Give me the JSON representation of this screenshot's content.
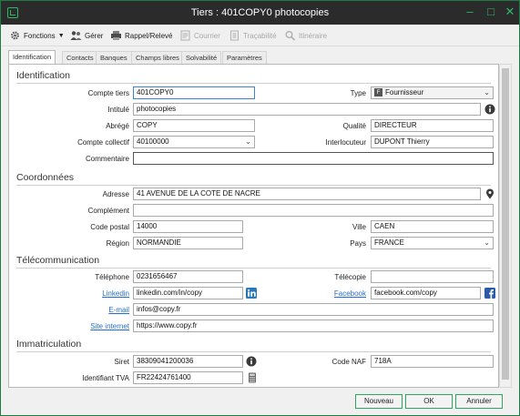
{
  "window": {
    "title": "Tiers : 401COPY0 photocopies",
    "accent": "#2fb66a"
  },
  "toolbar": {
    "fonctions": "Fonctions",
    "gerer": "Gérer",
    "rappel": "Rappel/Relevé",
    "courrier": "Courrier",
    "tracabilite": "Traçabilité",
    "itineraire": "Itinéraire"
  },
  "tabs": [
    "Identification",
    "Contacts",
    "Banques",
    "Champs libres",
    "Solvabilité",
    "Paramètres"
  ],
  "sections": {
    "identification": "Identification",
    "coordonnees": "Coordonnées",
    "telecommunication": "Télécommunication",
    "immatriculation": "Immatriculation"
  },
  "identification": {
    "compte_tiers_label": "Compte tiers",
    "compte_tiers": "401COPY0",
    "type_label": "Type",
    "type_badge": "F",
    "type": "Fournisseur",
    "intitule_label": "Intitulé",
    "intitule": "photocopies",
    "abrege_label": "Abrégé",
    "abrege": "COPY",
    "qualite_label": "Qualité",
    "qualite": "DIRECTEUR",
    "compte_collectif_label": "Compte collectif",
    "compte_collectif": "40100000",
    "interlocuteur_label": "Interlocuteur",
    "interlocuteur": "DUPONT Thierry",
    "commentaire_label": "Commentaire",
    "commentaire": ""
  },
  "coordonnees": {
    "adresse_label": "Adresse",
    "adresse": "41 AVENUE DE LA COTE DE NACRE",
    "complement_label": "Complément",
    "complement": "",
    "code_postal_label": "Code postal",
    "code_postal": "14000",
    "ville_label": "Ville",
    "ville": "CAEN",
    "region_label": "Région",
    "region": "NORMANDIE",
    "pays_label": "Pays",
    "pays": "FRANCE"
  },
  "telecom": {
    "telephone_label": "Téléphone",
    "telephone": "0231656467",
    "telecopie_label": "Télécopie",
    "telecopie": "",
    "linkedin_label": "Linkedin",
    "linkedin": "linkedin.com/in/copy",
    "facebook_label": "Facebook",
    "facebook": "facebook.com/copy",
    "email_label": "E-mail",
    "email": "infos@copy.fr",
    "site_label": "Site internet",
    "site": "https://www.copy.fr"
  },
  "immatriculation": {
    "siret_label": "Siret",
    "siret": "38309041200036",
    "code_naf_label": "Code NAF",
    "code_naf": "718A",
    "tva_label": "Identifiant TVA",
    "tva": "FR22424761400"
  },
  "buttons": {
    "nouveau": "Nouveau",
    "ok": "OK",
    "annuler": "Annuler"
  },
  "icons": [
    "app-icon",
    "minimize-icon",
    "maximize-icon",
    "close-icon",
    "gear-icon",
    "users-icon",
    "printer-icon",
    "letter-icon",
    "doc-icon",
    "search-icon",
    "info-icon",
    "map-pin-icon",
    "linkedin-icon",
    "facebook-icon",
    "calculator-icon",
    "chevron-down-icon"
  ]
}
